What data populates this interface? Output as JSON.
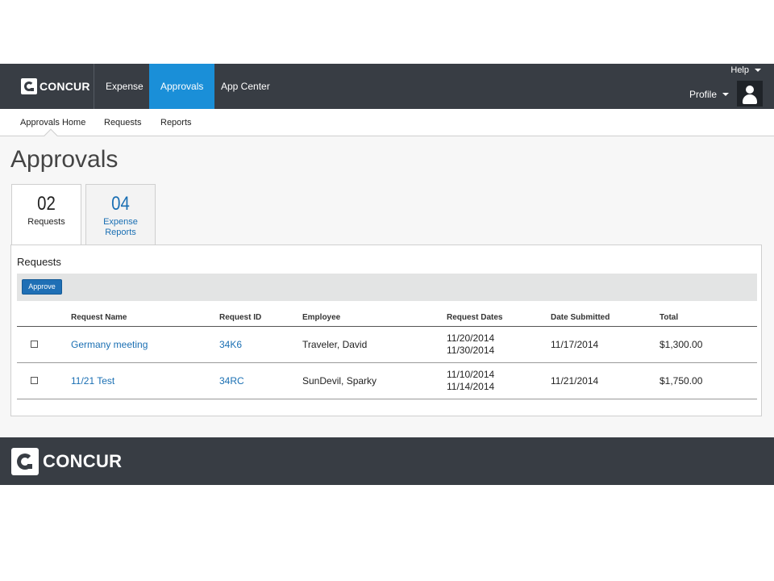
{
  "brand": {
    "name": "CONCUR"
  },
  "topnav": {
    "items": [
      {
        "label": "Expense"
      },
      {
        "label": "Approvals",
        "active": true
      },
      {
        "label": "App Center"
      }
    ],
    "help_label": "Help",
    "profile_label": "Profile"
  },
  "subnav": {
    "items": [
      {
        "label": "Approvals Home",
        "active": true
      },
      {
        "label": "Requests"
      },
      {
        "label": "Reports"
      }
    ]
  },
  "page": {
    "title": "Approvals"
  },
  "tabs": [
    {
      "count": "02",
      "label": "Requests",
      "active": true
    },
    {
      "count": "04",
      "label_line1": "Expense",
      "label_line2": "Reports",
      "active": false
    }
  ],
  "panel": {
    "title": "Requests",
    "approve_label": "Approve",
    "columns": [
      "",
      "Request Name",
      "Request ID",
      "Employee",
      "Request Dates",
      "Date Submitted",
      "Total"
    ],
    "rows": [
      {
        "name": "Germany meeting",
        "id": "34K6",
        "employee": "Traveler, David",
        "date_start": "11/20/2014",
        "date_end": "11/30/2014",
        "submitted": "11/17/2014",
        "total": "$1,300.00",
        "checked": false
      },
      {
        "name": "11/21 Test",
        "id": "34RC",
        "employee": "SunDevil, Sparky",
        "date_start": "11/10/2014",
        "date_end": "11/14/2014",
        "submitted": "11/21/2014",
        "total": "$1,750.00",
        "checked": false
      }
    ]
  },
  "colors": {
    "nav_bg": "#383d44",
    "accent": "#1a8fd8",
    "link": "#1a6fb3",
    "button": "#1f6fb5"
  },
  "footer": {
    "brand": "CONCUR"
  }
}
